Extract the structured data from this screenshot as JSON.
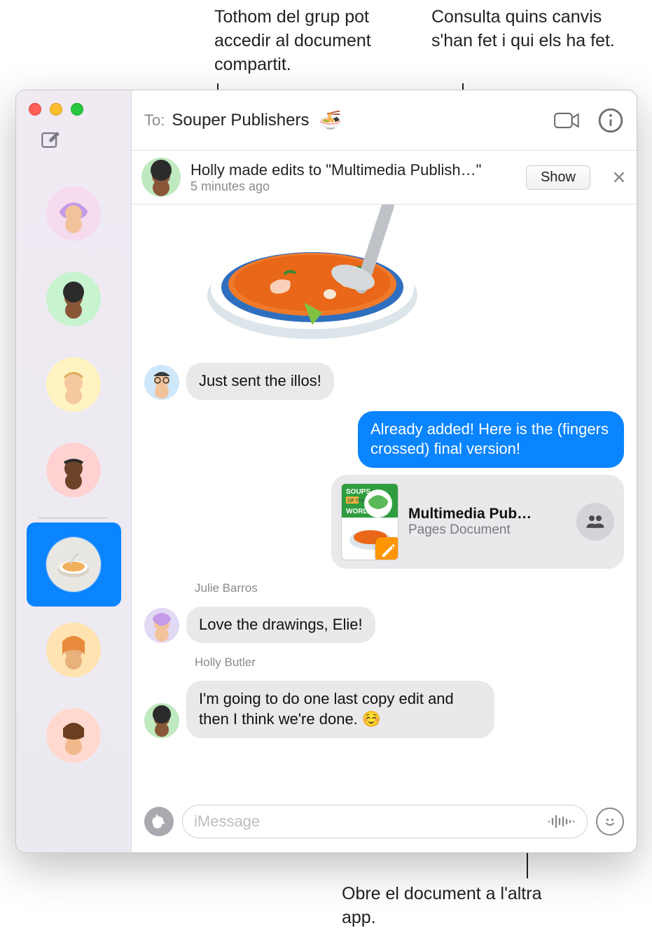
{
  "callouts": {
    "top_left": "Tothom del grup pot accedir al document compartit.",
    "top_right": "Consulta quins canvis s'han fet i qui els ha fet.",
    "bottom": "Obre el document a l'altra app."
  },
  "header": {
    "to_label": "To:",
    "to_value": "Souper Publishers",
    "emoji": "🍜"
  },
  "banner": {
    "title": "Holly made edits to \"Multimedia Publish…\"",
    "time": "5 minutes ago",
    "show_label": "Show"
  },
  "messages": {
    "m1_text": "Just sent the illos!",
    "m2_text": "Already added! Here is the (fingers crossed) final version!",
    "doc_title": "Multimedia Pub…",
    "doc_subtitle": "Pages Document",
    "doc_thumb_top": "SOUPS",
    "doc_thumb_mid": "OF THE",
    "doc_thumb_bot": "WORLD",
    "sender3": "Julie Barros",
    "m3_text": "Love the drawings, Elie!",
    "sender4": "Holly Butler",
    "m4_text": "I'm going to do one last copy edit and then I think we're done. ☺️"
  },
  "input": {
    "placeholder": "iMessage"
  },
  "sidebar": {
    "items": [
      {
        "bg": "#f6dbef"
      },
      {
        "bg": "#c8f3cf"
      },
      {
        "bg": "#fff3c1"
      },
      {
        "bg": "#ffd1d1"
      },
      {
        "bg": "#eae7e3"
      },
      {
        "bg": "#ffe3b0"
      },
      {
        "bg": "#ffd9cf"
      }
    ],
    "selected_index": 4
  }
}
